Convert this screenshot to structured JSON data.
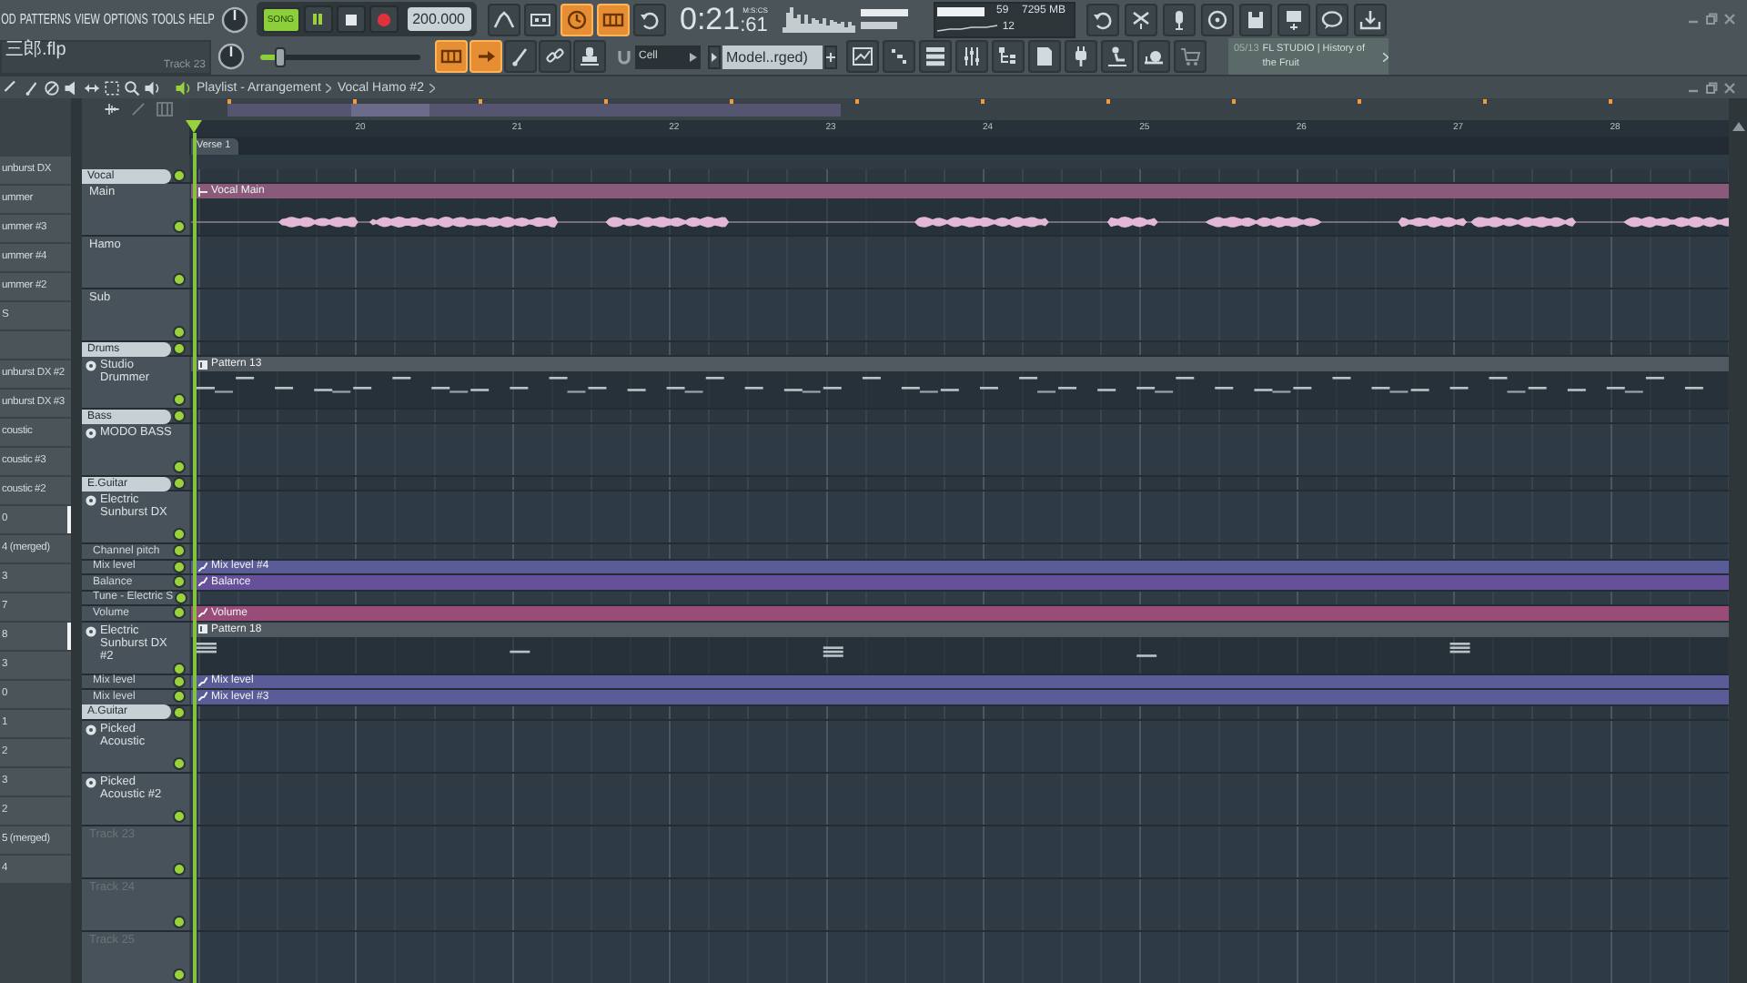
{
  "menu": [
    "OD",
    "PATTERNS",
    "VIEW",
    "OPTIONS",
    "TOOLS",
    "HELP"
  ],
  "transport": {
    "mode": "SONG",
    "song_mode": true,
    "tempo": "200.000"
  },
  "tool_buttons_top": [
    {
      "on": false
    },
    {
      "on": false
    },
    {
      "on": true
    },
    {
      "on": true
    },
    {
      "on": false
    }
  ],
  "time": {
    "main": "0:21",
    "sub": ":61",
    "unit": "M:S:CS"
  },
  "resources": {
    "polyphony": "59",
    "memory": "7295 MB",
    "cpu": "12"
  },
  "project": {
    "file": "三郎.flp",
    "hint": "Track 23"
  },
  "main_volume": {
    "level": 0.12
  },
  "tool_buttons_mid": [
    {
      "on": true
    },
    {
      "on": true
    },
    {
      "on": false
    },
    {
      "on": false
    },
    {
      "on": false
    }
  ],
  "snap": {
    "value": "Cell"
  },
  "pattern_selector": {
    "value": "Model..rged)"
  },
  "news": {
    "date": "05/13",
    "text": "FL STUDIO | History of the Fruit"
  },
  "playlist": {
    "breadcrumb": [
      "Playlist - Arrangement",
      "Vocal Hamo #2"
    ],
    "bars": [
      "20",
      "21",
      "22",
      "23",
      "24",
      "25",
      "26",
      "27",
      "28"
    ],
    "markers": [
      {
        "label": "Verse 1"
      }
    ]
  },
  "picker": [
    {
      "label": "unburst DX",
      "marked": false
    },
    {
      "label": "ummer",
      "marked": false
    },
    {
      "label": "ummer #3",
      "marked": false
    },
    {
      "label": "ummer #4",
      "marked": false
    },
    {
      "label": "ummer #2",
      "marked": false
    },
    {
      "label": "S",
      "marked": false
    },
    {
      "marked": false
    },
    {
      "label": "unburst DX #2",
      "marked": false
    },
    {
      "label": "unburst DX #3",
      "marked": false
    },
    {
      "label": "coustic",
      "marked": false
    },
    {
      "label": "coustic #3",
      "marked": false
    },
    {
      "label": "coustic #2",
      "marked": false
    },
    {
      "label": "0",
      "marked": true
    },
    {
      "label": "4 (merged)",
      "marked": false
    },
    {
      "label": "3",
      "marked": false
    },
    {
      "label": "7",
      "marked": false
    },
    {
      "label": "8",
      "marked": true
    },
    {
      "label": "3",
      "marked": false
    },
    {
      "label": "0",
      "marked": false
    },
    {
      "label": "1",
      "marked": false
    },
    {
      "label": "2",
      "marked": false
    },
    {
      "label": "3",
      "marked": false
    },
    {
      "label": "2",
      "marked": false
    },
    {
      "label": "5 (merged)",
      "marked": false
    },
    {
      "label": "4",
      "marked": false
    }
  ],
  "tracks": [
    {
      "kind": "group",
      "name": "Vocal",
      "enabled": true
    },
    {
      "kind": "audio",
      "name": "Main",
      "enabled": true,
      "clip": {
        "kind": "audio",
        "label": "Vocal Main",
        "color": "#8a5a7a"
      }
    },
    {
      "kind": "audio",
      "name": "Hamo",
      "enabled": true
    },
    {
      "kind": "audio",
      "name": "Sub",
      "enabled": true
    },
    {
      "kind": "group",
      "name": "Drums",
      "enabled": true
    },
    {
      "kind": "instrument",
      "name": "Studio Drummer",
      "enabled": true,
      "clip": {
        "kind": "pattern",
        "label": "Pattern 13",
        "color": "#4f595f"
      }
    },
    {
      "kind": "group",
      "name": "Bass",
      "enabled": true
    },
    {
      "kind": "instrument",
      "name": "MODO BASS",
      "enabled": true
    },
    {
      "kind": "group",
      "name": "E.Guitar",
      "enabled": true
    },
    {
      "kind": "instrument",
      "name": "Electric Sunburst DX",
      "enabled": true
    },
    {
      "kind": "automation",
      "name": "Channel pitch",
      "enabled": true
    },
    {
      "kind": "automation",
      "name": "Mix level",
      "enabled": true,
      "clip": {
        "kind": "automation",
        "label": "Mix level #4",
        "color": "#5a5c98"
      }
    },
    {
      "kind": "automation",
      "name": "Balance",
      "enabled": true,
      "clip": {
        "kind": "automation",
        "label": "Balance",
        "color": "#66509a"
      }
    },
    {
      "kind": "automation",
      "name": "Tune - Electric S",
      "enabled": true
    },
    {
      "kind": "automation",
      "name": "Volume",
      "enabled": true,
      "clip": {
        "kind": "automation",
        "label": "Volume",
        "color": "#9a4c78"
      }
    },
    {
      "kind": "instrument",
      "name": "Electric Sunburst DX #2",
      "enabled": true,
      "clip": {
        "kind": "pattern",
        "label": "Pattern 18",
        "color": "#4f595f"
      }
    },
    {
      "kind": "automation",
      "name": "Mix level",
      "enabled": true,
      "clip": {
        "kind": "automation",
        "label": "Mix level",
        "color": "#5a5c98"
      }
    },
    {
      "kind": "automation",
      "name": "Mix level",
      "enabled": true,
      "clip": {
        "kind": "automation",
        "label": "Mix level #3",
        "color": "#5a5c98"
      }
    },
    {
      "kind": "group",
      "name": "A.Guitar",
      "enabled": true
    },
    {
      "kind": "instrument",
      "name": "Picked Acoustic",
      "enabled": true
    },
    {
      "kind": "instrument",
      "name": "Picked Acoustic #2",
      "enabled": true
    },
    {
      "kind": "empty",
      "name": "Track 23",
      "enabled": true
    },
    {
      "kind": "empty",
      "name": "Track 24",
      "enabled": true
    },
    {
      "kind": "empty",
      "name": "Track 25",
      "enabled": true
    }
  ]
}
